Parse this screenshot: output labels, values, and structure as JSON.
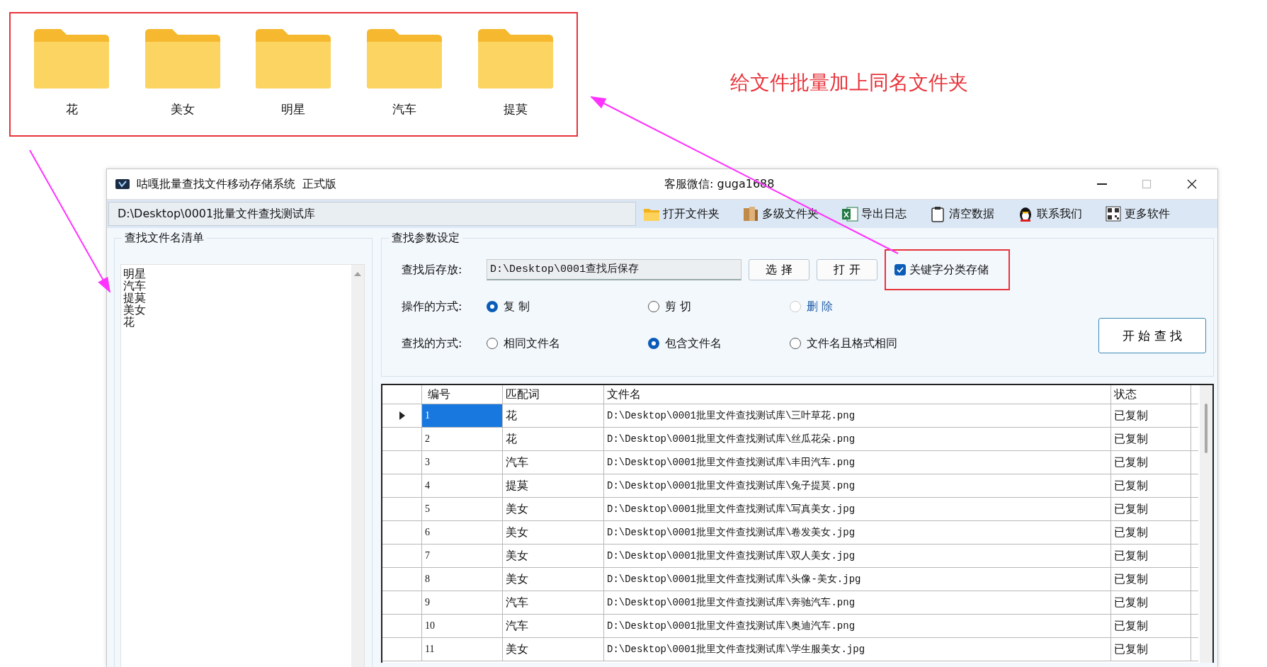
{
  "annotation_panel": {
    "folders": [
      {
        "label": "花"
      },
      {
        "label": "美女"
      },
      {
        "label": "明星"
      },
      {
        "label": "汽车"
      },
      {
        "label": "提莫"
      }
    ]
  },
  "annotation_text": "给文件批量加上同名文件夹",
  "window": {
    "title": "咕嘎批量查找文件移动存储系统",
    "edition": "正式版",
    "contact": "客服微信: guga1688",
    "path": "D:\\Desktop\\0001批量文件查找测试库"
  },
  "toolbar": [
    {
      "label": "打开文件夹",
      "kind": "folder"
    },
    {
      "label": "多级文件夹",
      "kind": "boxes"
    },
    {
      "label": "导出日志",
      "kind": "spreadsheet"
    },
    {
      "label": "清空数据",
      "kind": "clipboard"
    },
    {
      "label": "联系我们",
      "kind": "penguin"
    },
    {
      "label": "更多软件",
      "kind": "qr"
    }
  ],
  "name_list": {
    "title": "查找文件名清单",
    "items": [
      "明星",
      "汽车",
      "提莫",
      "美女",
      "花"
    ]
  },
  "params": {
    "title": "查找参数设定",
    "save_label": "查找后存放:",
    "save_path": "D:\\Desktop\\0001查找后保存",
    "buttons": [
      "选 择",
      "打 开"
    ],
    "classify": {
      "label": "关键字分类存储",
      "checked": true
    },
    "operation": {
      "label": "操作的方式:",
      "options": [
        {
          "label": "复 制",
          "selected": true,
          "disabled": false
        },
        {
          "label": "剪 切",
          "selected": false,
          "disabled": false
        },
        {
          "label": "删 除",
          "selected": false,
          "disabled": true
        }
      ]
    },
    "match": {
      "label": "查找的方式:",
      "options": [
        {
          "label": "相同文件名",
          "selected": false,
          "disabled": false
        },
        {
          "label": "包含文件名",
          "selected": true,
          "disabled": false
        },
        {
          "label": "文件名且格式相同",
          "selected": false,
          "disabled": false
        }
      ]
    },
    "start_button": "开 始 查 找"
  },
  "table": {
    "columns": [
      "编号",
      "匹配词",
      "文件名",
      "状态"
    ],
    "rows": [
      {
        "selected": true,
        "cells": [
          "1",
          "花",
          "D:\\Desktop\\0001批里文件查找测试库\\三叶草花.png",
          "已复制"
        ]
      },
      {
        "selected": false,
        "cells": [
          "2",
          "花",
          "D:\\Desktop\\0001批里文件查找测试库\\丝瓜花朵.png",
          "已复制"
        ]
      },
      {
        "selected": false,
        "cells": [
          "3",
          "汽车",
          "D:\\Desktop\\0001批里文件查找测试库\\丰田汽车.png",
          "已复制"
        ]
      },
      {
        "selected": false,
        "cells": [
          "4",
          "提莫",
          "D:\\Desktop\\0001批里文件查找测试库\\兔子提莫.png",
          "已复制"
        ]
      },
      {
        "selected": false,
        "cells": [
          "5",
          "美女",
          "D:\\Desktop\\0001批里文件查找测试库\\写真美女.jpg",
          "已复制"
        ]
      },
      {
        "selected": false,
        "cells": [
          "6",
          "美女",
          "D:\\Desktop\\0001批里文件查找测试库\\卷发美女.jpg",
          "已复制"
        ]
      },
      {
        "selected": false,
        "cells": [
          "7",
          "美女",
          "D:\\Desktop\\0001批里文件查找测试库\\双人美女.jpg",
          "已复制"
        ]
      },
      {
        "selected": false,
        "cells": [
          "8",
          "美女",
          "D:\\Desktop\\0001批里文件查找测试库\\头像-美女.jpg",
          "已复制"
        ]
      },
      {
        "selected": false,
        "cells": [
          "9",
          "汽车",
          "D:\\Desktop\\0001批里文件查找测试库\\奔驰汽车.png",
          "已复制"
        ]
      },
      {
        "selected": false,
        "cells": [
          "10",
          "汽车",
          "D:\\Desktop\\0001批里文件查找测试库\\奥迪汽车.png",
          "已复制"
        ]
      },
      {
        "selected": false,
        "cells": [
          "11",
          "美女",
          "D:\\Desktop\\0001批里文件查找测试库\\学生服美女.jpg",
          "已复制"
        ]
      }
    ]
  }
}
